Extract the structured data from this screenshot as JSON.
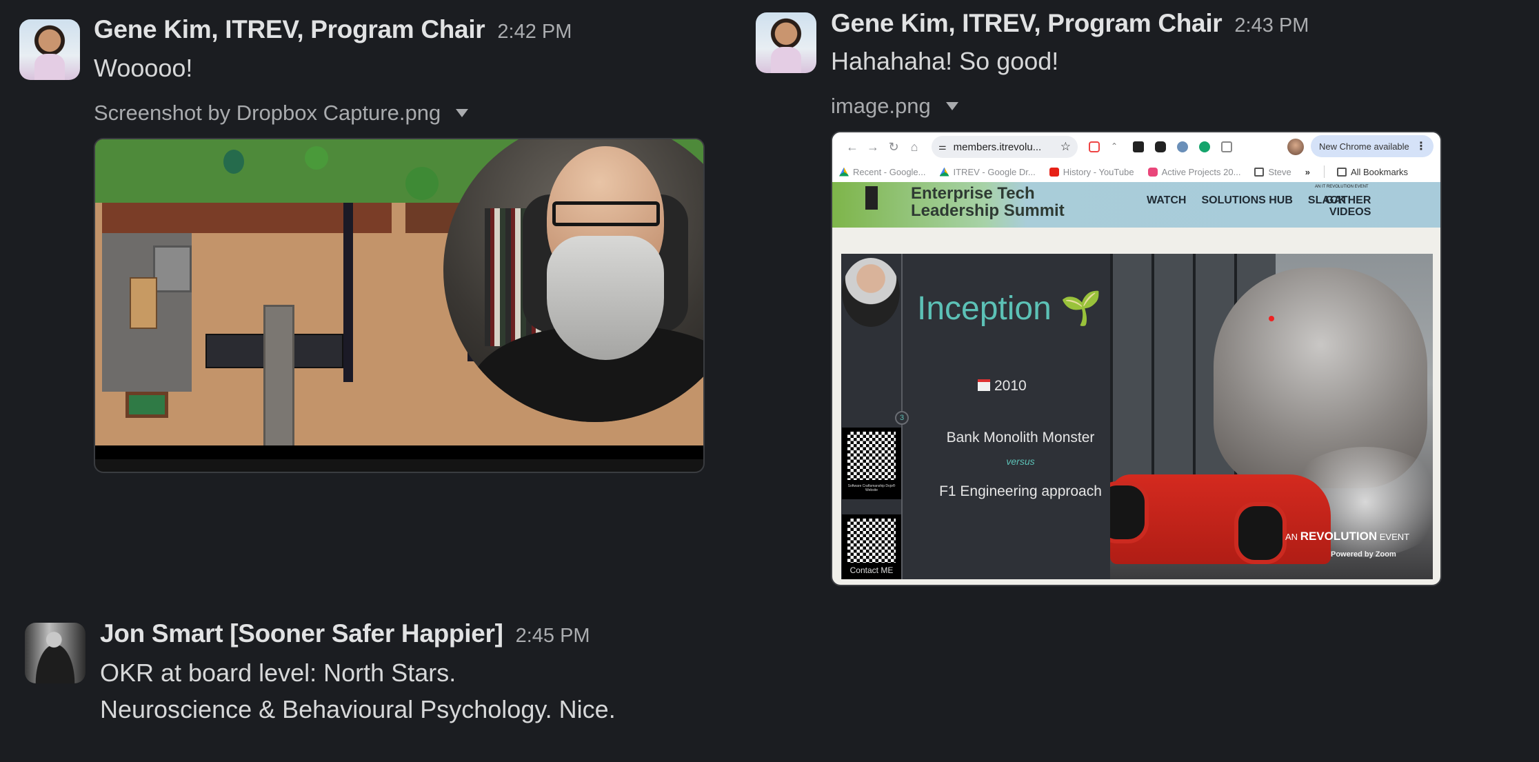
{
  "messages": [
    {
      "author": "Gene Kim, ITREV, Program Chair",
      "time": "2:42 PM",
      "text": "Wooooo!",
      "attachment": {
        "filename": "Screenshot by Dropbox Capture.png",
        "description": "Gather virtual office map with circular webcam video of bearded presenter"
      }
    },
    {
      "author": "Gene Kim, ITREV, Program Chair",
      "time": "2:43 PM",
      "text": "Hahahaha!  So good!",
      "attachment": {
        "filename": "image.png",
        "browser": {
          "nav_icons": [
            "back-arrow-icon",
            "forward-arrow-icon",
            "reload-icon",
            "home-icon"
          ],
          "nav_glyphs": [
            "←",
            "→",
            "↻",
            "⌂"
          ],
          "url": "members.itrevolu...",
          "update_pill": "New Chrome available",
          "bookmarks": [
            {
              "label": "Recent - Google...",
              "icon": "drive"
            },
            {
              "label": "ITREV - Google Dr...",
              "icon": "drive"
            },
            {
              "label": "History - YouTube",
              "icon": "yt"
            },
            {
              "label": "Active Projects 20...",
              "icon": "ig"
            },
            {
              "label": "Steve",
              "icon": "folder"
            }
          ],
          "bookmarks_overflow": "»",
          "all_bookmarks": "All Bookmarks"
        },
        "site": {
          "title_line1": "Enterprise Tech",
          "title_line2": "Leadership Summit",
          "nav": [
            "WATCH",
            "SOLUTIONS HUB",
            "SLACK"
          ],
          "gather_line1": "GATHER",
          "gather_line2": "VIDEOS",
          "tag": "AN IT REVOLUTION EVENT"
        },
        "slide": {
          "title": "Inception",
          "title_emoji": "🌱",
          "year": "2010",
          "step": "3",
          "line1": "Bank Monolith Monster",
          "versus": "versus",
          "line2": "F1 Engineering approach",
          "qr1_caption": "Software Craftsmanship Dojo® Website",
          "qr2_caption": "Contact ME",
          "event_prefix": "AN",
          "event_name": "REVOLUTION",
          "event_suffix": "EVENT",
          "powered_by": "Powered by Zoom"
        }
      }
    },
    {
      "author": "Jon Smart [Sooner Safer Happier]",
      "time": "2:45 PM",
      "lines": [
        "OKR at board level: North Stars.",
        "Neuroscience & Behavioural Psychology. Nice."
      ]
    }
  ],
  "colors": {
    "background": "#1b1d21",
    "author": "#e1e2e3",
    "timestamp": "#abadb0",
    "slide_accent": "#5cc1b6"
  }
}
